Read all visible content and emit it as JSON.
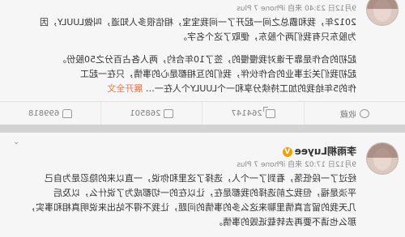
{
  "post1": {
    "meta": "9月12日 23:40 来自 iPhone 7 Plus",
    "lines": [
      "2012年，我和霸总之间一起开了一间我宝宝，相信很多人知道，叫做LUULY，因",
      "为股东只有我们两个股东，便取了这个名字。",
      "",
      "起初的合作是靠于谁对我慢慢的，签了10年合约，两人各占百分之50股份。",
      "起初我们关注事业的合作伙伴，我们的互相都是心的事情，只在一起工",
      "作的5年给我的加工持续分享和一个LUULY个人在一"
    ],
    "expand": "展开全文",
    "toolbar": {
      "favorite": "收藏",
      "repost": "264147",
      "comment": "268501",
      "like": "699818"
    }
  },
  "post2": {
    "name": "李雨桐Luyee",
    "badge": "V",
    "meta": "9月12日 17:02 来自 iPhone 7 Plus",
    "lines": [
      "经过了一段低落，看到了一个人，选择了这里和你说，一直以来的隐忍是为自己",
      "平淡是福，但我之前选择的我都是在，让以在的一切都成为了说什么，以及后",
      "几天我的留言真情里聊来这么多的事情的问题，让我不得不站出来说明真相和事实，",
      "那么也请不要再去转载诋毁的事情。"
    ],
    "more": "⌄"
  }
}
